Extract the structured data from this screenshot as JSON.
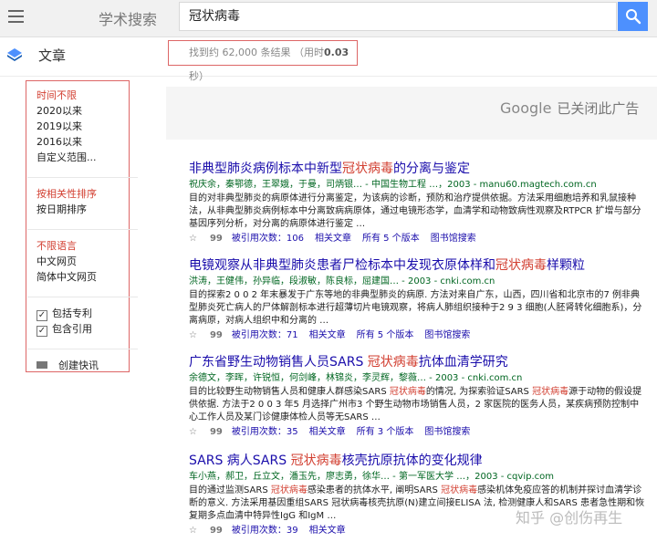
{
  "header": {
    "brand": "学术搜索",
    "query": "冠状病毒"
  },
  "subheader": {
    "section": "文章",
    "results_prefix": "找到约 62,000 条结果 （用时",
    "results_time": "0.03",
    "results_suffix": "秒）"
  },
  "sidebar": {
    "time_options": [
      "时间不限",
      "2020以来",
      "2019以来",
      "2016以来",
      "自定义范围..."
    ],
    "sort_options": [
      "按相关性排序",
      "按日期排序"
    ],
    "lang_options": [
      "不限语言",
      "中文网页",
      "简体中文网页"
    ],
    "include_patents": "包括专利",
    "include_citations": "包含引用",
    "create_alert": "创建快讯"
  },
  "ad": {
    "google": "Google",
    "text": "已关闭此广告"
  },
  "results": [
    {
      "title_pre": "非典型肺炎病例标本中新型",
      "title_hl": "冠状病毒",
      "title_post": "的分离与鉴定",
      "meta": "祝庆余，秦鄂德，王翠娥，于曼，司炳银… - 中国生物工程 …，2003 - manu60.magtech.com.cn",
      "snippet": "目的对非典型肺炎的病原体进行分离鉴定，为该病的诊断，预防和治疗提供依据。方法采用细胞培养和乳鼠接种法，从非典型肺炎病例标本中分离致病病原体，通过电镜形态学，血清学和动物致病性观察及RTPCR 扩增与部分基因序列分析，对分离的病原体进行鉴定 …",
      "cited": "被引用次数：106",
      "related": "相关文章",
      "versions": "所有 5 个版本",
      "library": "图书馆搜索"
    },
    {
      "title_pre": "电镜观察从非典型肺炎患者尸检标本中发现衣原体样和",
      "title_hl": "冠状病毒",
      "title_post": "样颗粒",
      "meta": "洪涛，王健伟，孙异临，段淑敏，陈良标，屈建国… - 2003 - cnki.com.cn",
      "snippet": "目的探索2 0 0 2 年末暴发于广东等地的非典型肺炎的病原. 方法对来自广东，山西，四川省和北京市的7 例非典型肺炎死亡病人的尸体解剖标本进行超薄切片电镜观察，将病人肺组织接种于2 9 3 细胞(人胚肾转化细胞系)，分离病原，对病人组织中和分离的 …",
      "cited": "被引用次数：71",
      "related": "相关文章",
      "versions": "所有 5 个版本",
      "library": "图书馆搜索"
    },
    {
      "title_pre": "广东省野生动物销售人员SARS ",
      "title_hl": "冠状病毒",
      "title_post": "抗体血清学研究",
      "meta": "余德文，李晖，许锐恒，何剑峰，林锦炎，李灵辉，黎薇… - 2003 - cnki.com.cn",
      "snippet_pre": "目的比较野生动物销售人员和健康人群感染SARS ",
      "snippet_hl1": "冠状病毒",
      "snippet_mid": "的情况, 为探索验证SARS ",
      "snippet_hl2": "冠状病毒",
      "snippet_post": "源于动物的假设提供依据. 方法于2 0 0 3 年5 月选择广州市3 个野生动物市场销售人员，2 家医院的医务人员，某疾病预防控制中心工作人员及某门诊健康体检人员等无SARS …",
      "cited": "被引用次数：35",
      "related": "相关文章",
      "versions": "所有 3 个版本",
      "library": "图书馆搜索"
    },
    {
      "title_pre": "SARS 病人SARS ",
      "title_hl": "冠状病毒",
      "title_post": "核壳抗原抗体的变化规律",
      "meta": "车小燕，郝卫，丘立文，潘玉先，廖志勇，徐华… - 第一军医大学 …，2003 - cqvip.com",
      "snippet_pre": "目的通过监测SARS ",
      "snippet_hl1": "冠状病毒",
      "snippet_mid": "感染患者的抗体水平, 阐明SARS ",
      "snippet_hl2": "冠状病毒",
      "snippet_post": "感染机体免疫应答的机制并探讨血清学诊断的意义. 方法采用基因重组SARS 冠状病毒核壳抗原(N)建立间接ELISA 法, 检测健康人和SARS 患者急性期和恢复期多点血清中特异性IgG 和IgM …",
      "cited": "被引用次数：39",
      "related": "相关文章",
      "versions": "",
      "library": ""
    }
  ],
  "watermark": "知乎 @创伤再生"
}
